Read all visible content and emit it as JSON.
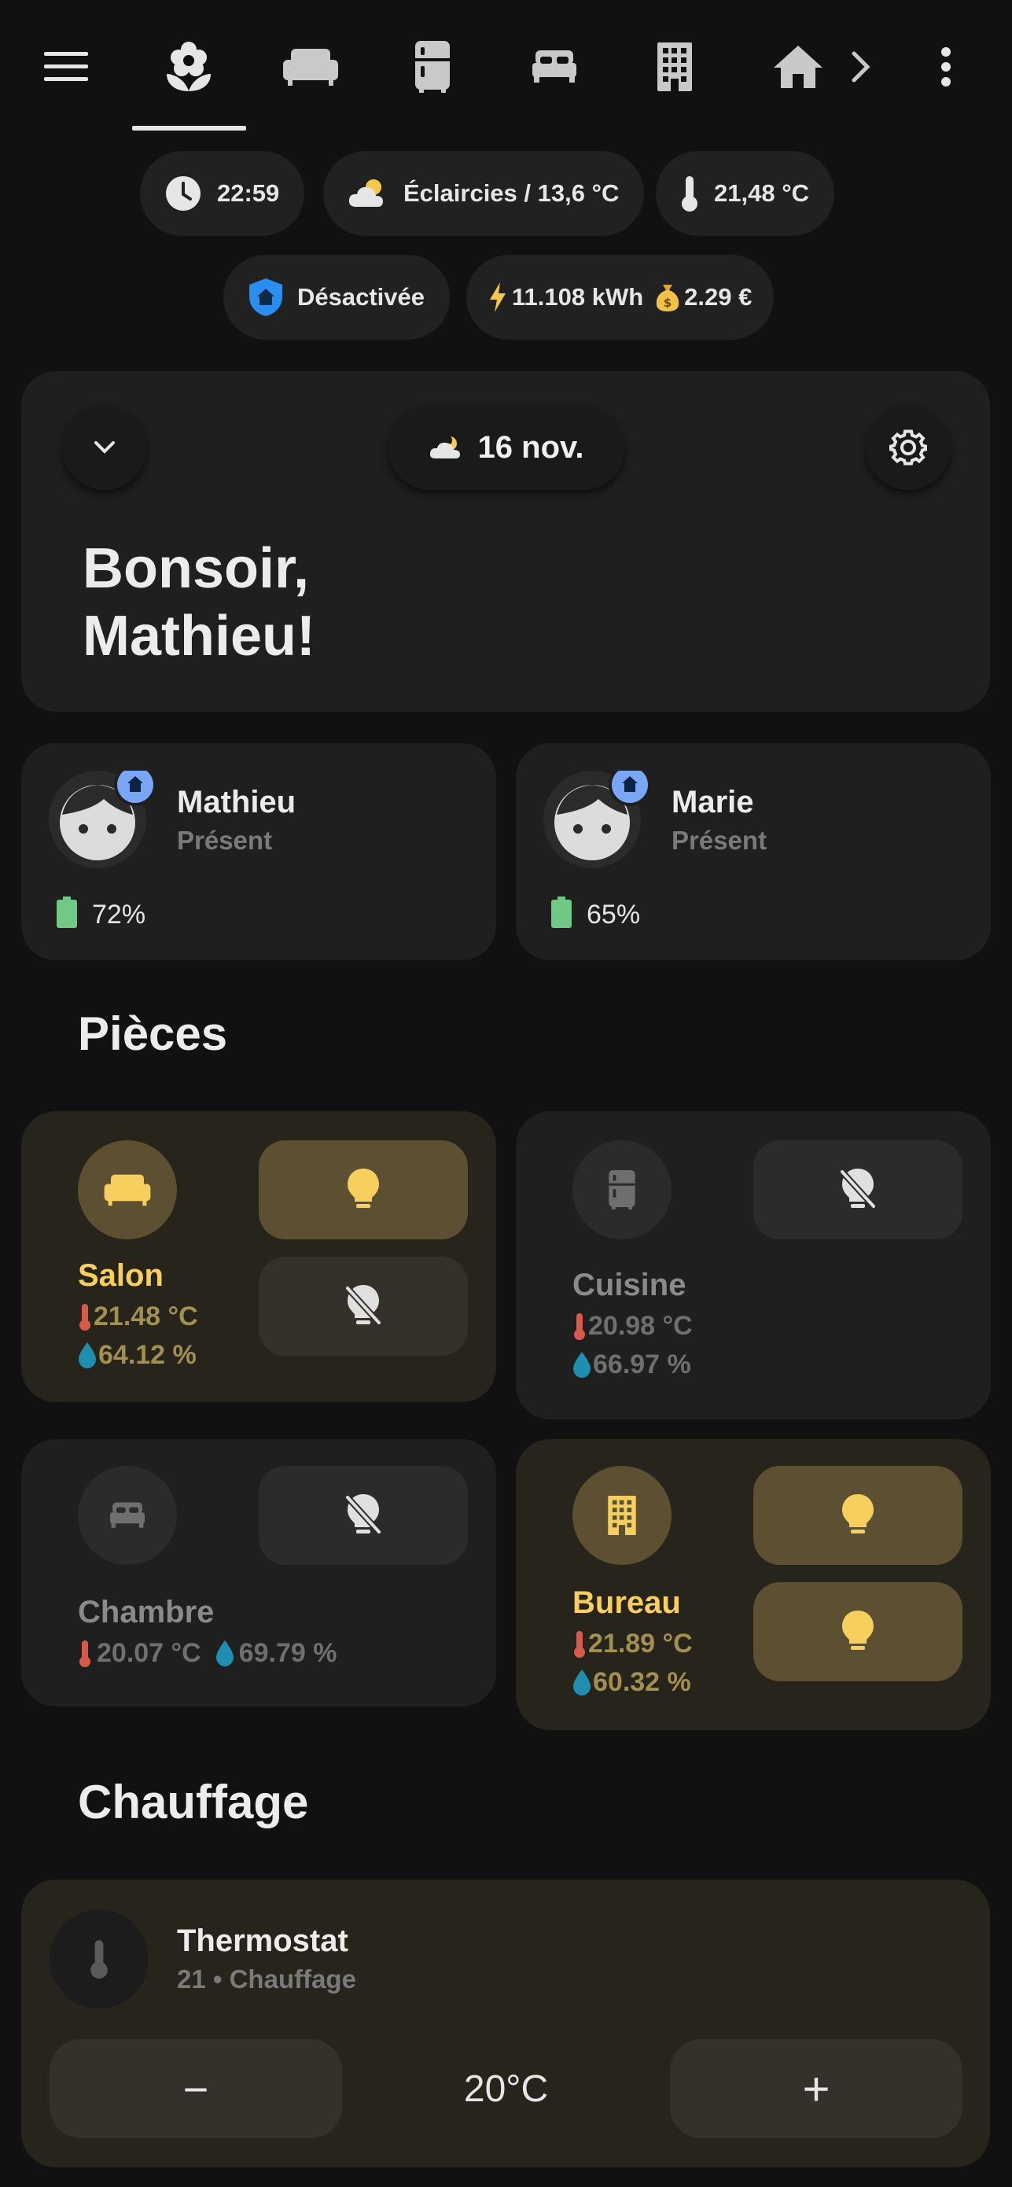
{
  "nav": {
    "icons": [
      "menu-icon",
      "flower-icon",
      "sofa-icon",
      "fridge-icon",
      "bed-icon",
      "office-building-icon",
      "home-icon",
      "chevron-right-icon",
      "more-vertical-icon"
    ],
    "active_tab": "flower-icon"
  },
  "chips": {
    "time": "22:59",
    "weather": "Éclaircies / 13,6 °C",
    "temperature": "21,48 °C",
    "alarm": "Désactivée",
    "energy": "11.108 kWh",
    "cost": "2.29 €"
  },
  "header": {
    "date": "16 nov.",
    "greeting_line1": "Bonsoir,",
    "greeting_line2": "Mathieu!"
  },
  "people": [
    {
      "name": "Mathieu",
      "status": "Présent",
      "battery": "72%"
    },
    {
      "name": "Marie",
      "status": "Présent",
      "battery": "65%"
    }
  ],
  "rooms_section": {
    "title": "Pièces"
  },
  "rooms": [
    {
      "name": "Salon",
      "temp": "21.48 °C",
      "humidity": "64.12 %",
      "active": true
    },
    {
      "name": "Cuisine",
      "temp": "20.98 °C",
      "humidity": "66.97 %",
      "active": false
    },
    {
      "name": "Chambre",
      "temp": "20.07 °C",
      "humidity": "69.79 %",
      "active": false
    },
    {
      "name": "Bureau",
      "temp": "21.89 °C",
      "humidity": "60.32 %",
      "active": true
    }
  ],
  "heating_section": {
    "title": "Chauffage"
  },
  "thermostat": {
    "name": "Thermostat",
    "state": "21 • Chauffage",
    "target": "20°C",
    "minus": "−",
    "plus": "+"
  },
  "colors": {
    "background": "#111111",
    "card": "#1f1f1f",
    "card_active": "#27241b",
    "accent_yellow": "#f7cf5f",
    "light_on_bg": "#5d5032",
    "presence_badge": "#7aa7f5",
    "shield_blue": "#2a8ef0",
    "battery_green": "#71c985"
  }
}
